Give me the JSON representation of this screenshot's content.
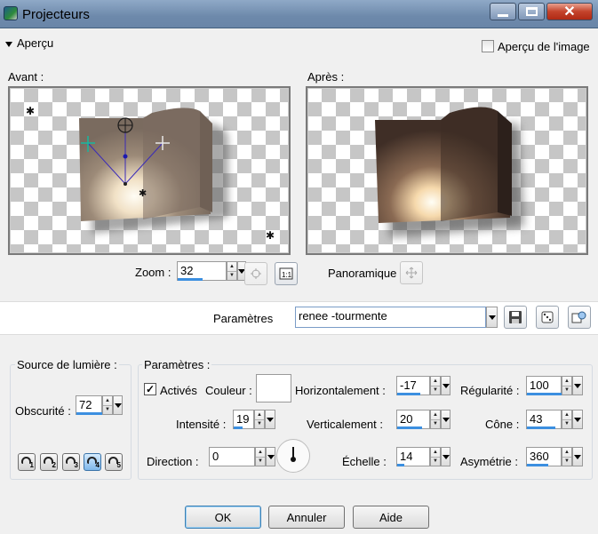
{
  "window": {
    "title": "Projecteurs"
  },
  "apercu": {
    "label": "Aperçu",
    "image_preview_label": "Aperçu de l'image",
    "image_preview_checked": false
  },
  "preview": {
    "before_label": "Avant :",
    "after_label": "Après :"
  },
  "zoom": {
    "label": "Zoom :",
    "value": "32"
  },
  "pan": {
    "label": "Panoramique"
  },
  "params_strip": {
    "label": "Paramètres",
    "preset": "renee -tourmente"
  },
  "light_source": {
    "title": "Source de lumière :",
    "darkness_label": "Obscurité :",
    "darkness_value": "72",
    "lights": [
      "1",
      "2",
      "3",
      "4",
      "5"
    ],
    "active_light": "4"
  },
  "parameters": {
    "title": "Paramètres :",
    "active_label": "Activés",
    "active_checked": true,
    "color_label": "Couleur :",
    "color_value": "#ffffff",
    "horizontal_label": "Horizontalement :",
    "horizontal_value": "-17",
    "regularity_label": "Régularité :",
    "regularity_value": "100",
    "intensity_label": "Intensité :",
    "intensity_value": "19",
    "vertical_label": "Verticalement :",
    "vertical_value": "20",
    "cone_label": "Cône :",
    "cone_value": "43",
    "direction_label": "Direction :",
    "direction_value": "0",
    "scale_label": "Échelle :",
    "scale_value": "14",
    "asymmetry_label": "Asymétrie :",
    "asymmetry_value": "360"
  },
  "footer": {
    "ok": "OK",
    "cancel": "Annuler",
    "help": "Aide"
  },
  "colors": {
    "accent_blue": "#3c8fe0",
    "close_red": "#c4432b"
  }
}
